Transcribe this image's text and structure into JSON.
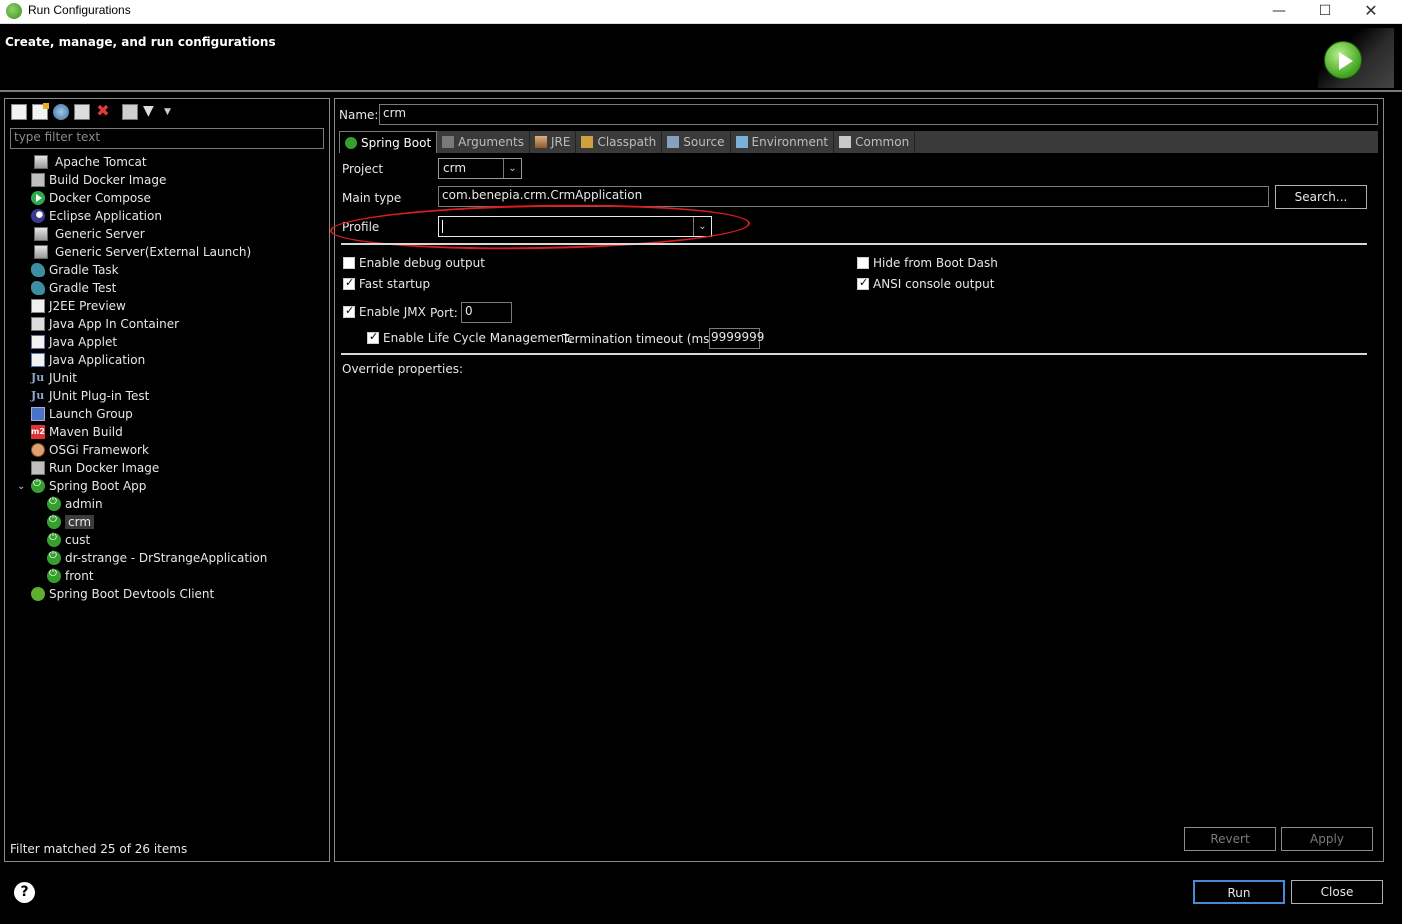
{
  "window": {
    "title": "Run Configurations",
    "minimize": "—",
    "maximize": "☐",
    "close": "✕"
  },
  "header": {
    "title": "Create, manage, and run configurations"
  },
  "left": {
    "filter_placeholder": "type filter text",
    "tree": [
      {
        "label": "Apache Tomcat",
        "icon": "server-icon"
      },
      {
        "label": "Build Docker Image",
        "icon": "docker-icon"
      },
      {
        "label": "Docker Compose",
        "icon": "compose-icon"
      },
      {
        "label": "Eclipse Application",
        "icon": "eclipse-icon"
      },
      {
        "label": "Generic Server",
        "icon": "server-icon"
      },
      {
        "label": "Generic Server(External Launch)",
        "icon": "server-icon"
      },
      {
        "label": "Gradle Task",
        "icon": "gradle-icon"
      },
      {
        "label": "Gradle Test",
        "icon": "gradle-icon"
      },
      {
        "label": "J2EE Preview",
        "icon": "j2ee-icon"
      },
      {
        "label": "Java App In Container",
        "icon": "container-icon"
      },
      {
        "label": "Java Applet",
        "icon": "applet-icon"
      },
      {
        "label": "Java Application",
        "icon": "java-app-icon"
      },
      {
        "label": "JUnit",
        "icon": "junit-icon"
      },
      {
        "label": "JUnit Plug-in Test",
        "icon": "junit-icon"
      },
      {
        "label": "Launch Group",
        "icon": "launch-group-icon"
      },
      {
        "label": "Maven Build",
        "icon": "maven-icon"
      },
      {
        "label": "OSGi Framework",
        "icon": "osgi-icon"
      },
      {
        "label": "Run Docker Image",
        "icon": "docker-icon"
      },
      {
        "label": "Spring Boot App",
        "icon": "spring-boot-icon"
      },
      {
        "label": "admin",
        "icon": "spring-boot-icon"
      },
      {
        "label": "crm",
        "icon": "spring-boot-icon"
      },
      {
        "label": "cust",
        "icon": "spring-boot-icon"
      },
      {
        "label": "dr-strange - DrStrangeApplication",
        "icon": "spring-boot-icon"
      },
      {
        "label": "front",
        "icon": "spring-boot-icon"
      },
      {
        "label": "Spring Boot Devtools Client",
        "icon": "devtools-icon"
      }
    ],
    "status": "Filter matched 25 of 26 items"
  },
  "right": {
    "name_label": "Name:",
    "name_value": "crm",
    "tabs": [
      "Spring Boot",
      "Arguments",
      "JRE",
      "Classpath",
      "Source",
      "Environment",
      "Common"
    ],
    "project_label": "Project",
    "project_value": "crm",
    "main_type_label": "Main type",
    "main_type_value": "com.benepia.crm.CrmApplication",
    "search_label": "Search...",
    "profile_label": "Profile",
    "profile_value": "",
    "enable_debug": "Enable debug output",
    "fast_startup": "Fast startup",
    "hide_boot_dash": "Hide from Boot Dash",
    "ansi_console": "ANSI console output",
    "enable_jmx": "Enable JMX",
    "port_label": "Port:",
    "port_value": "0",
    "life_cycle": "Enable Life Cycle Management.",
    "termination_label": "Termination timeout (ms):",
    "termination_value": "9999999",
    "override_label": "Override properties:",
    "revert_label": "Revert",
    "apply_label": "Apply",
    "accent_annotation": "#d81e1e"
  },
  "footer": {
    "run_label": "Run",
    "close_label": "Close",
    "help": "?"
  }
}
